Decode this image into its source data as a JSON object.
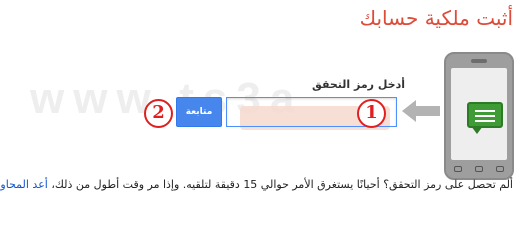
{
  "page": {
    "title": "أثبت ملكية حسابك"
  },
  "watermark": {
    "text": "www.ts3a"
  },
  "illustration": {
    "phone_icon": "phone-icon",
    "message_icon": "message-bubble-icon",
    "arrow_icon": "arrow-left-icon"
  },
  "form": {
    "code_label": "أدخل رمز التحقق",
    "code_value": "",
    "continue_label": "متابعة"
  },
  "annotations": {
    "step_1": "1",
    "step_2": "2"
  },
  "help": {
    "text": "ألم تحصل على رمز التحقق؟ أحيانًا يستغرق الأمر حوالي 15 دقيقة لتلقيه. وإذا مر وقت أطول من ذلك، ",
    "retry_link": "أعد المحاولة",
    "end": "."
  },
  "colors": {
    "title": "#dd4b39",
    "button": "#4787ed",
    "input_border": "#4d90fe",
    "badge": "#e02020",
    "link": "#1155cc",
    "message_icon": "#3f9b36"
  }
}
